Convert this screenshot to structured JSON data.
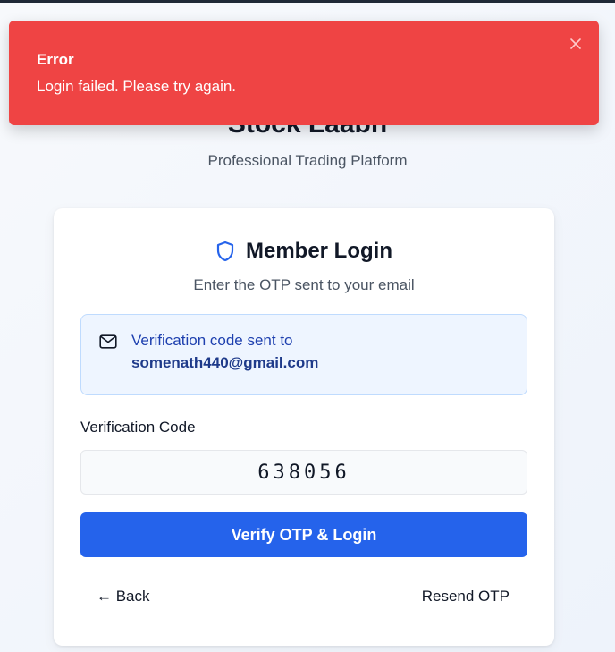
{
  "toast": {
    "title": "Error",
    "message": "Login failed. Please try again.",
    "close_icon": "close-icon",
    "color": "#ef4444"
  },
  "brand": {
    "title": "Stock Laabh",
    "subtitle": "Professional Trading Platform"
  },
  "card": {
    "title": "Member Login",
    "title_icon": "shield-icon",
    "description": "Enter the OTP sent to your email",
    "info": {
      "icon": "mail-icon",
      "text": "Verification code sent to",
      "email": "somenath440@gmail.com"
    },
    "otp_field": {
      "label": "Verification Code",
      "value": "638056"
    },
    "verify_button": "Verify OTP & Login",
    "back_link": "← Back",
    "resend_link": "Resend OTP",
    "accent_color": "#2563eb"
  }
}
